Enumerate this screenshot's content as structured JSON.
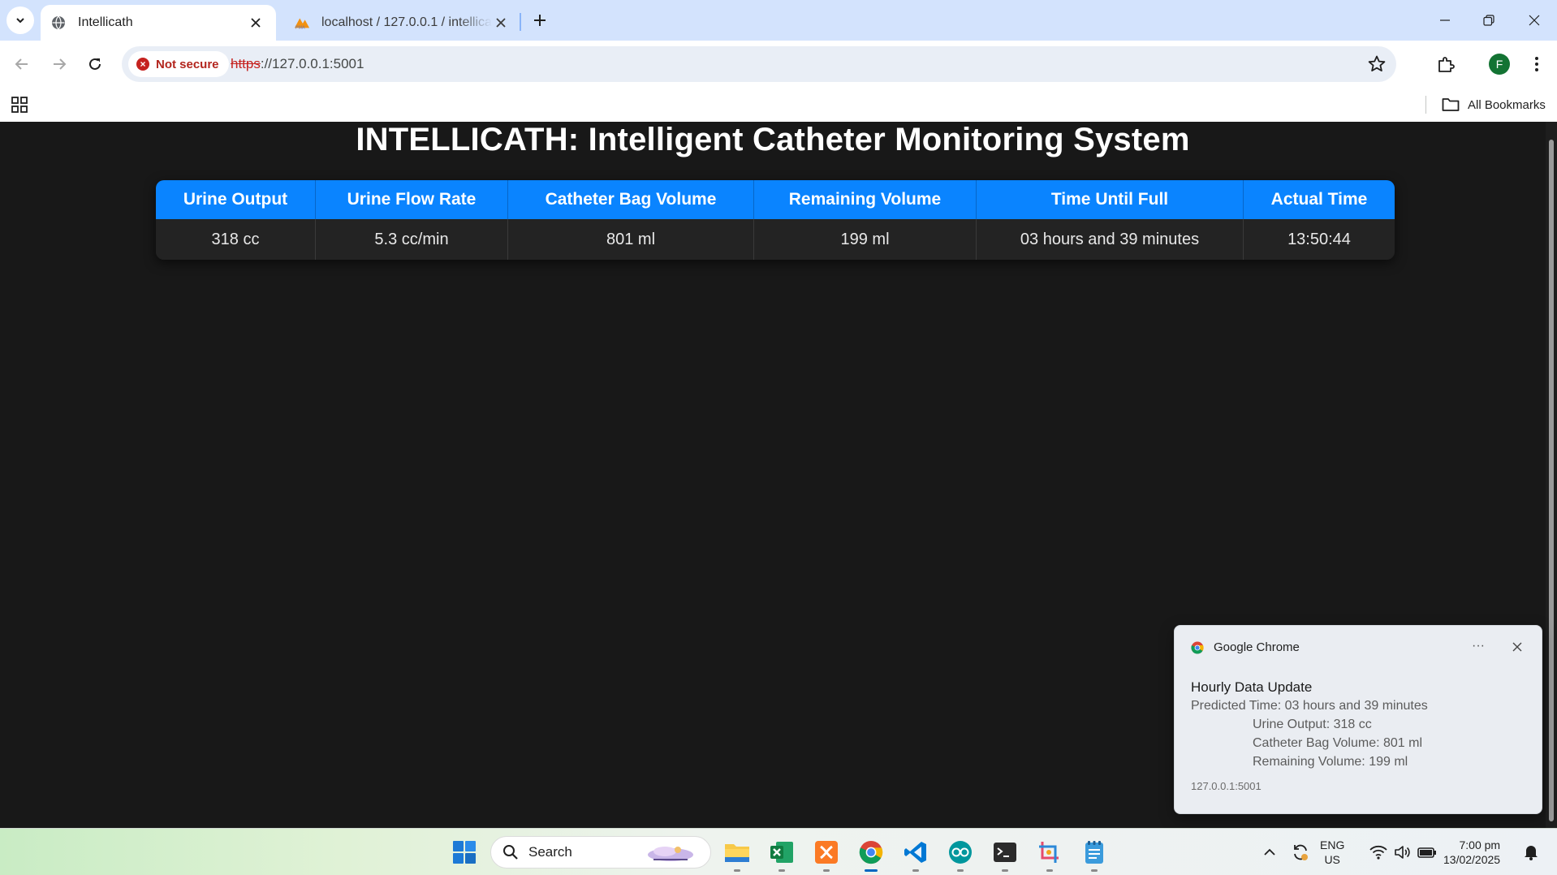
{
  "browser": {
    "tabs": [
      {
        "title": "Intellicath",
        "favicon": "globe-icon",
        "active": true
      },
      {
        "title": "localhost / 127.0.0.1 / intellicath",
        "favicon": "phpmyadmin-icon",
        "active": false
      }
    ],
    "security_label": "Not secure",
    "url_scheme": "https",
    "url_rest": "://127.0.0.1:5001",
    "profile_initial": "F",
    "all_bookmarks_label": "All Bookmarks"
  },
  "page": {
    "title": "INTELLICATH: Intelligent Catheter Monitoring System",
    "table": {
      "headers": [
        "Urine Output",
        "Urine Flow Rate",
        "Catheter Bag Volume",
        "Remaining Volume",
        "Time Until Full",
        "Actual Time"
      ],
      "row": [
        "318 cc",
        "5.3 cc/min",
        "801 ml",
        "199 ml",
        "03 hours and 39 minutes",
        "13:50:44"
      ]
    }
  },
  "notification": {
    "app_name": "Google Chrome",
    "more_label": "···",
    "heading": "Hourly Data Update",
    "lines": [
      "Predicted Time: 03 hours and 39 minutes",
      "Urine Output: 318 cc",
      "Catheter Bag Volume: 801 ml",
      "Remaining Volume: 199 ml"
    ],
    "origin": "127.0.0.1:5001"
  },
  "taskbar": {
    "search_label": "Search",
    "apps": [
      "start-icon",
      "file-explorer-icon",
      "excel-icon",
      "xampp-icon",
      "chrome-icon",
      "vscode-icon",
      "arduino-icon",
      "terminal-icon",
      "snipping-tool-icon",
      "notepad-icon"
    ],
    "active_app": "chrome-icon",
    "language": "ENG",
    "region": "US",
    "time": "7:00 pm",
    "date": "13/02/2025"
  },
  "colors": {
    "tabstrip": "#d3e3fd",
    "page_background": "#181818",
    "table_header": "#0a84ff",
    "insecure": "#c5221f"
  }
}
